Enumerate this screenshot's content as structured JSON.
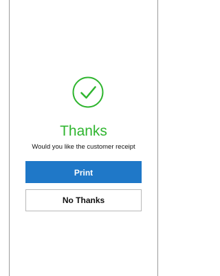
{
  "screen": {
    "icon": "check-circle-icon",
    "title": "Thanks",
    "subtitle": "Would you like the customer receipt"
  },
  "actions": {
    "print_label": "Print",
    "no_thanks_label": "No Thanks"
  },
  "colors": {
    "success": "#2fb52f",
    "primary": "#1f78c8"
  }
}
